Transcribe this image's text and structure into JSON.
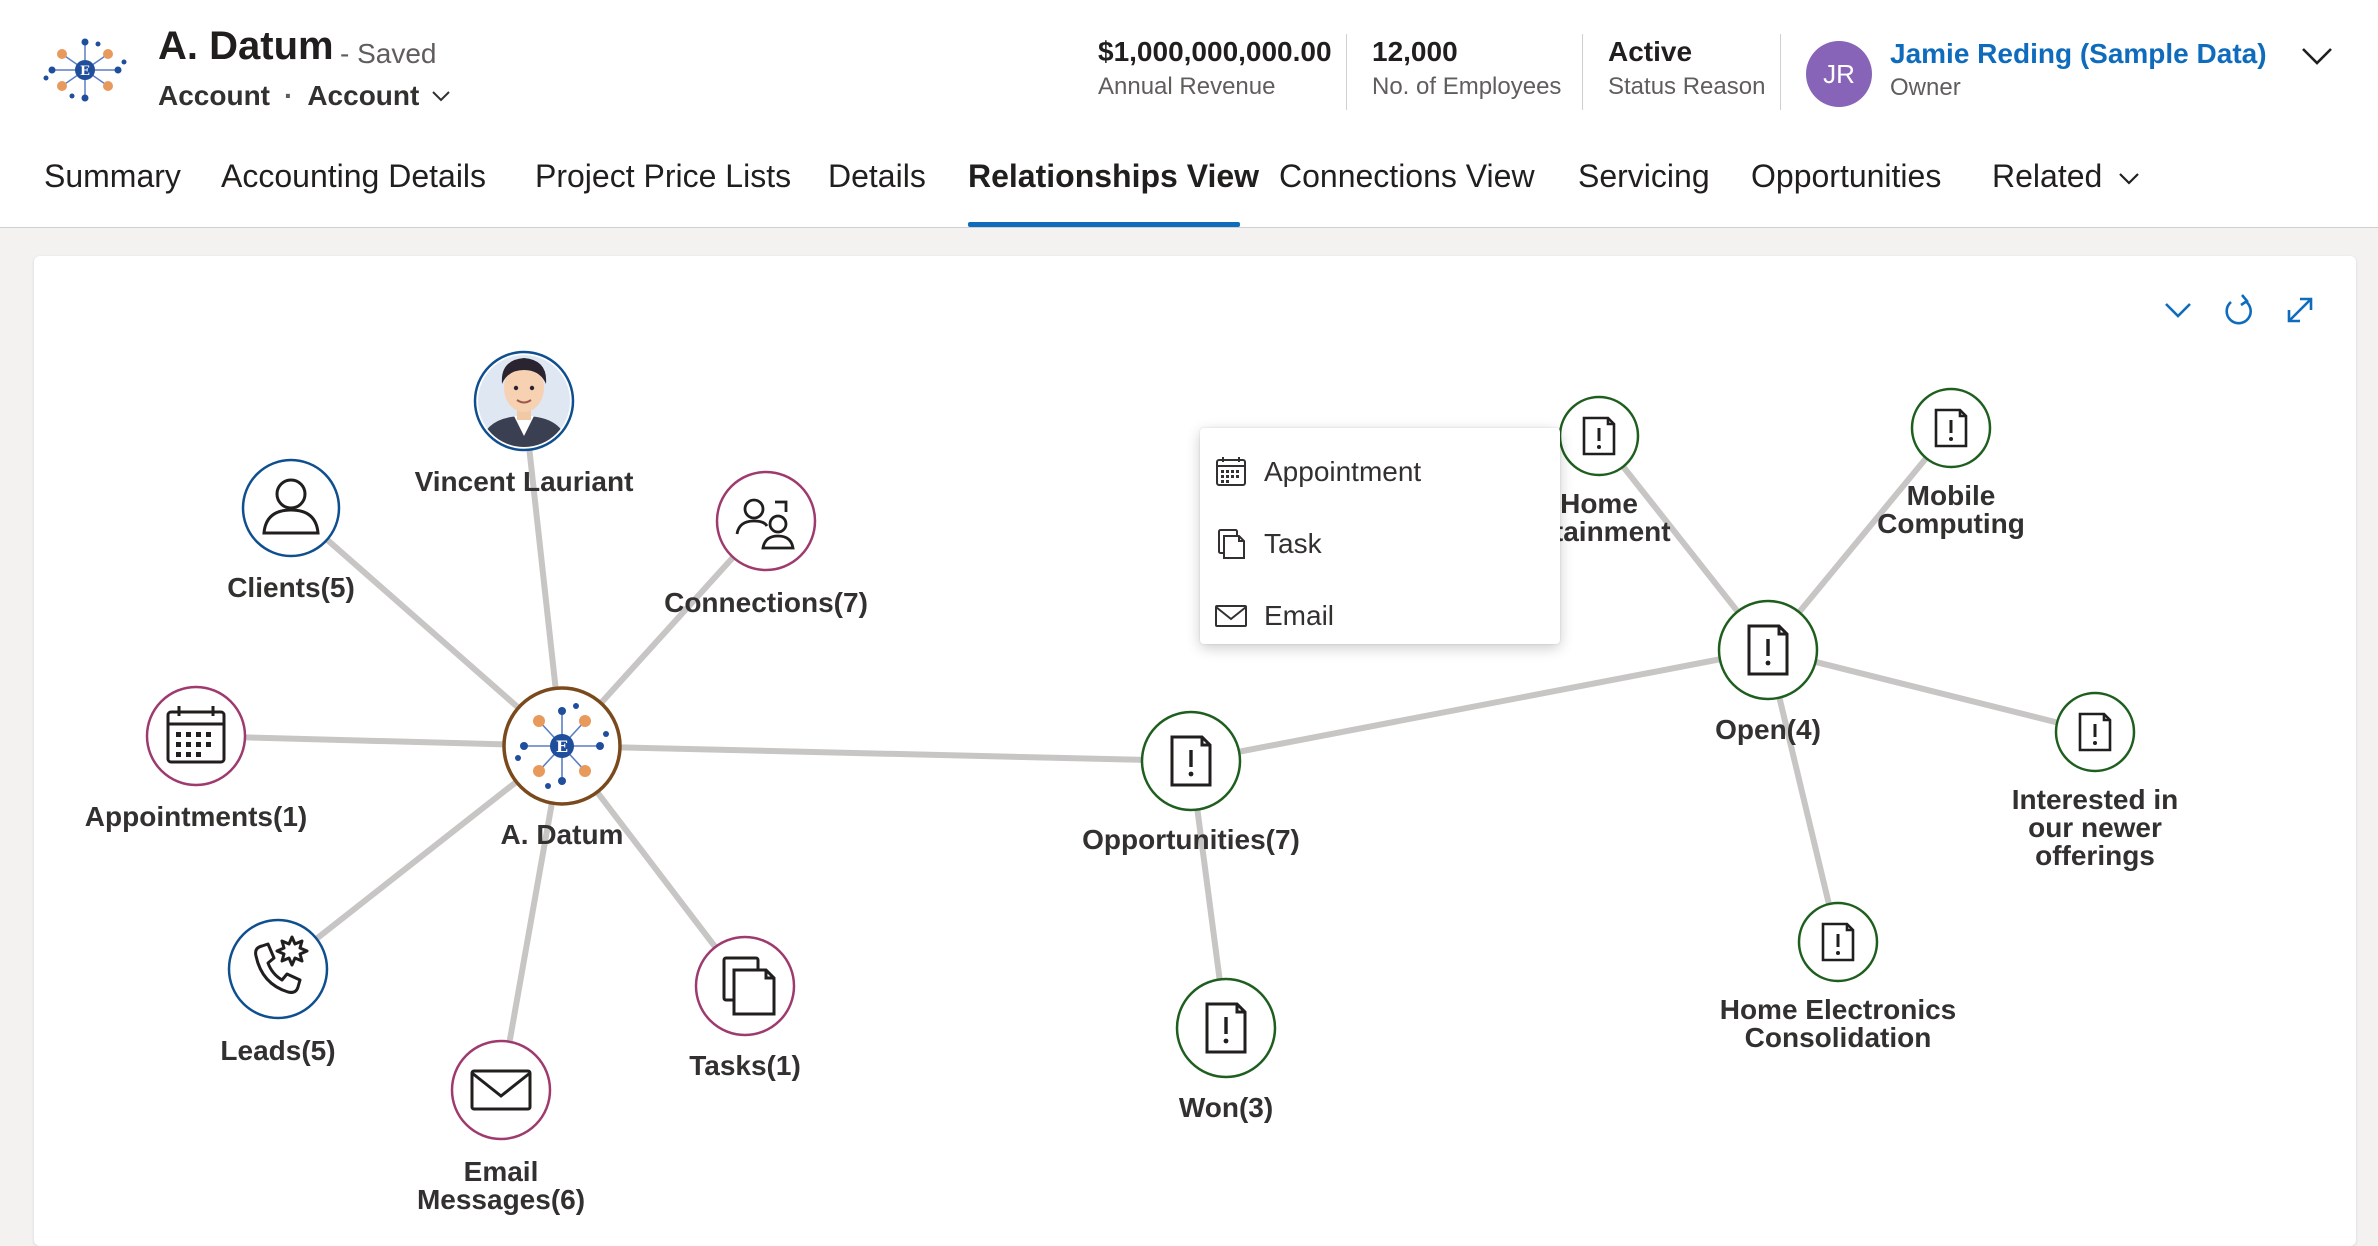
{
  "record": {
    "title": "A. Datum",
    "saved_label": "- Saved",
    "entity": "Account",
    "form": "Account"
  },
  "kpis": [
    {
      "value": "$1,000,000,000.00",
      "label": "Annual Revenue"
    },
    {
      "value": "12,000",
      "label": "No. of Employees"
    },
    {
      "value": "Active",
      "label": "Status Reason"
    }
  ],
  "owner": {
    "initials": "JR",
    "name": "Jamie Reding (Sample Data)",
    "label": "Owner",
    "avatar_color": "#8764b8"
  },
  "tabs": [
    {
      "label": "Summary"
    },
    {
      "label": "Accounting Details"
    },
    {
      "label": "Project Price Lists"
    },
    {
      "label": "Details"
    },
    {
      "label": "Relationships View",
      "active": true
    },
    {
      "label": "Connections View"
    },
    {
      "label": "Servicing"
    },
    {
      "label": "Opportunities"
    },
    {
      "label": "Related"
    }
  ],
  "toolbar": [
    {
      "icon": "chevron-down-icon"
    },
    {
      "icon": "refresh-icon"
    },
    {
      "icon": "expand-icon"
    }
  ],
  "graph": {
    "nodes": {
      "adatum": {
        "label": "A. Datum",
        "icon": "account-logo-icon",
        "border": "#7a4a1d"
      },
      "vincent": {
        "label": "Vincent Lauriant",
        "icon": "person-photo-icon",
        "border": "#0f6cbd"
      },
      "clients": {
        "label": "Clients(5)",
        "icon": "person-icon",
        "border": "#0f6cbd"
      },
      "connections": {
        "label": "Connections(7)",
        "icon": "people-icon",
        "border": "#9e3a6e"
      },
      "appointments": {
        "label": "Appointments(1)",
        "icon": "calendar-icon",
        "border": "#9e3a6e"
      },
      "leads": {
        "label": "Leads(5)",
        "icon": "phone-icon",
        "border": "#0f6cbd"
      },
      "email": {
        "label_lines": [
          "Email",
          "Messages(6)"
        ],
        "icon": "mail-icon",
        "border": "#9e3a6e"
      },
      "tasks": {
        "label": "Tasks(1)",
        "icon": "task-icon",
        "border": "#9e3a6e"
      },
      "opportunities": {
        "label": "Opportunities(7)",
        "icon": "opportunity-icon",
        "border": "#1e5e1e"
      },
      "won": {
        "label": "Won(3)",
        "icon": "opportunity-icon",
        "border": "#1e5e1e"
      },
      "open": {
        "label": "Open(4)",
        "icon": "opportunity-icon",
        "border": "#1e5e1e"
      },
      "home_ent": {
        "label_lines": [
          "Home",
          "ertainment"
        ],
        "icon": "opportunity-icon",
        "border": "#1e5e1e"
      },
      "mobile": {
        "label_lines": [
          "Mobile",
          "Computing"
        ],
        "icon": "opportunity-icon",
        "border": "#1e5e1e"
      },
      "interested": {
        "label_lines": [
          "Interested in",
          "our newer",
          "offerings"
        ],
        "icon": "opportunity-icon",
        "border": "#1e5e1e"
      },
      "home_elec": {
        "label_lines": [
          "Home Electronics",
          "Consolidation"
        ],
        "icon": "opportunity-icon",
        "border": "#1e5e1e"
      }
    },
    "edge_color": "#c8c6c4"
  },
  "context_menu": {
    "items": [
      {
        "label": "Appointment",
        "icon": "calendar-icon"
      },
      {
        "label": "Task",
        "icon": "task-icon"
      },
      {
        "label": "Email",
        "icon": "mail-icon"
      }
    ]
  }
}
